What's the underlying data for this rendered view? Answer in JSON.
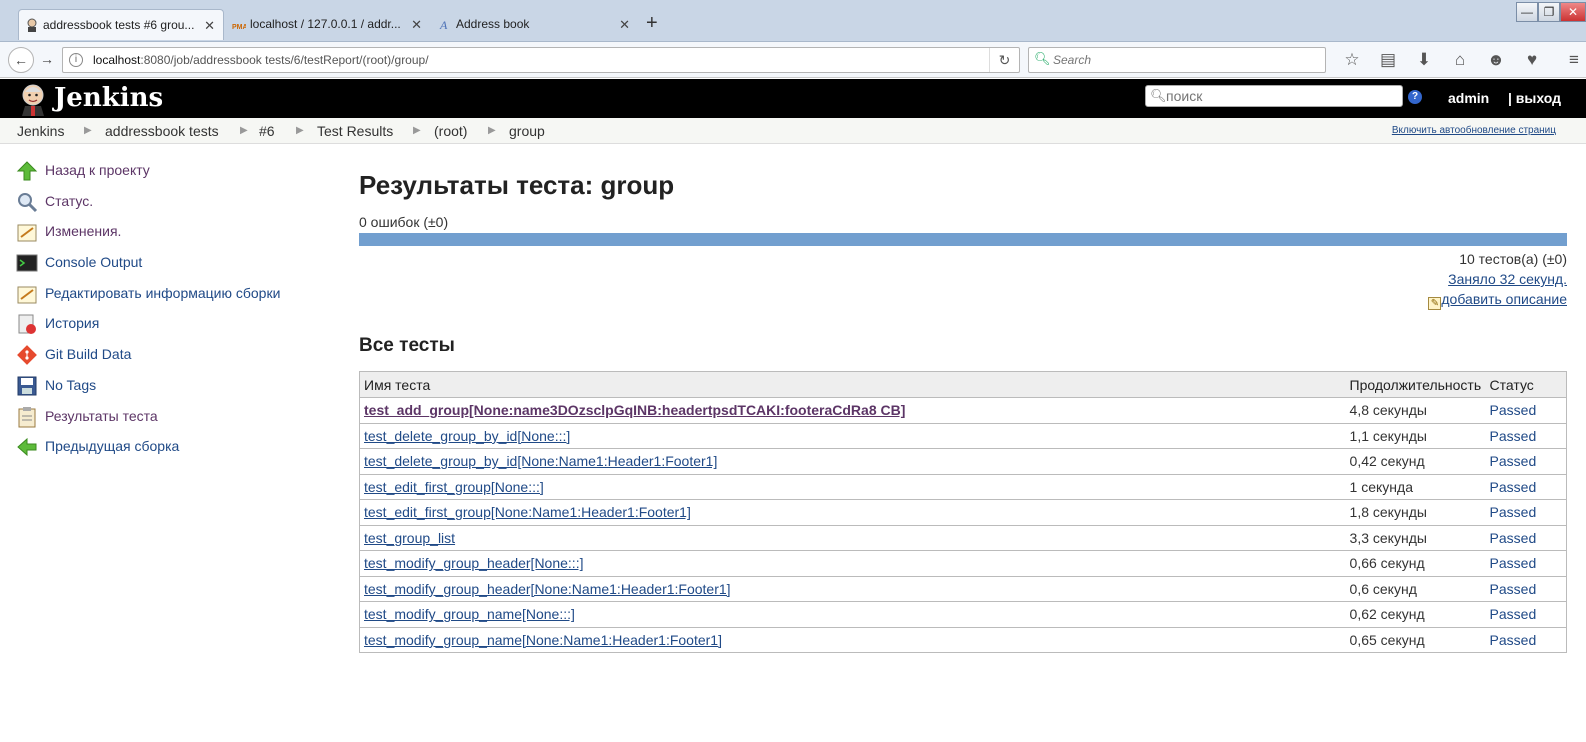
{
  "browser": {
    "tabs": [
      {
        "title": "addressbook tests #6 grou...",
        "icon": "jenkins-icon",
        "active": true
      },
      {
        "title": "localhost / 127.0.0.1 / addr...",
        "icon": "phpmyadmin-icon",
        "active": false
      },
      {
        "title": "Address book",
        "icon": "a-icon",
        "active": false
      }
    ],
    "new_tab": "+",
    "url_host": "localhost",
    "url_rest": ":8080/job/addressbook tests/6/testReport/(root)/group/",
    "search_placeholder": "Search"
  },
  "jenkins": {
    "title": "Jenkins",
    "search_placeholder": "поиск",
    "help": "?",
    "user": "admin",
    "logout": "| выход"
  },
  "breadcrumb": {
    "items": [
      "Jenkins",
      "addressbook tests",
      "#6",
      "Test Results",
      "(root)",
      "group"
    ],
    "autorefresh": "Включить автообновление страниц"
  },
  "sidebar": {
    "items": [
      {
        "label": "Назад к проекту",
        "icon": "up-arrow-icon"
      },
      {
        "label": "Статус.",
        "icon": "search-icon"
      },
      {
        "label": "Изменения.",
        "icon": "notepad-icon"
      },
      {
        "label": "Console Output",
        "icon": "terminal-icon"
      },
      {
        "label": "Редактировать информацию сборки",
        "icon": "notepad-icon"
      },
      {
        "label": "История",
        "icon": "history-icon"
      },
      {
        "label": "Git Build Data",
        "icon": "git-icon"
      },
      {
        "label": "No Tags",
        "icon": "save-icon"
      },
      {
        "label": "Результаты теста",
        "icon": "clipboard-icon"
      },
      {
        "label": "Предыдущая сборка",
        "icon": "left-arrow-icon"
      }
    ]
  },
  "main": {
    "title": "Результаты теста: group",
    "failures": "0 ошибок (±0)",
    "pass_fraction": 1.0,
    "tests_count": "10 тестов(а) (±0)",
    "duration": "Заняло 32 секунд.",
    "add_description": "добавить описание",
    "all_tests_heading": "Все тесты",
    "columns": [
      "Имя теста",
      "Продолжительность",
      "Статус"
    ],
    "rows": [
      {
        "name": "test_add_group[None:name3DOzsclpGqINB:headertpsdTCAKI:footeraCdRa8 CB]",
        "duration": "4,8 секунды",
        "status": "Passed"
      },
      {
        "name": "test_delete_group_by_id[None:::]",
        "duration": "1,1 секунды",
        "status": "Passed"
      },
      {
        "name": "test_delete_group_by_id[None:Name1:Header1:Footer1]",
        "duration": "0,42 секунд",
        "status": "Passed"
      },
      {
        "name": "test_edit_first_group[None:::]",
        "duration": "1 секунда",
        "status": "Passed"
      },
      {
        "name": "test_edit_first_group[None:Name1:Header1:Footer1]",
        "duration": "1,8 секунды",
        "status": "Passed"
      },
      {
        "name": "test_group_list",
        "duration": "3,3 секунды",
        "status": "Passed"
      },
      {
        "name": "test_modify_group_header[None:::]",
        "duration": "0,66 секунд",
        "status": "Passed"
      },
      {
        "name": "test_modify_group_header[None:Name1:Header1:Footer1]",
        "duration": "0,6 секунд",
        "status": "Passed"
      },
      {
        "name": "test_modify_group_name[None:::]",
        "duration": "0,62 секунд",
        "status": "Passed"
      },
      {
        "name": "test_modify_group_name[None:Name1:Header1:Footer1]",
        "duration": "0,65 секунд",
        "status": "Passed"
      }
    ]
  }
}
